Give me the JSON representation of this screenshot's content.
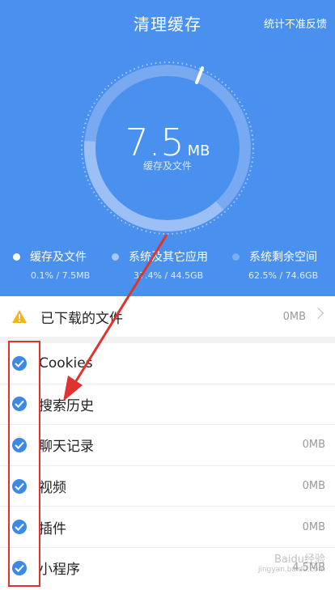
{
  "header": {
    "title": "清理缓存",
    "feedback_link": "统计不准反馈",
    "total_size_value": "7.5",
    "total_size_unit": "MB",
    "total_size_label": "缓存及文件"
  },
  "stats": [
    {
      "name": "缓存及文件",
      "value": "0.1% / 7.5MB",
      "dot_color": "#ffffff"
    },
    {
      "name": "系统及其它应用",
      "value": "37.4% / 44.5GB",
      "dot_color": "#a9c8f5"
    },
    {
      "name": "系统剩余空间",
      "value": "62.5% / 74.6GB",
      "dot_color": "#7eaef0"
    }
  ],
  "downloaded": {
    "label": "已下载的文件",
    "size": "0MB",
    "icon": "warning-icon"
  },
  "items": [
    {
      "label": "Cookies",
      "size": "",
      "checked": true
    },
    {
      "label": "搜索历史",
      "size": "",
      "checked": true
    },
    {
      "label": "聊天记录",
      "size": "0MB",
      "checked": true
    },
    {
      "label": "视频",
      "size": "0MB",
      "checked": true
    },
    {
      "label": "插件",
      "size": "0MB",
      "checked": true
    },
    {
      "label": "小程序",
      "size": "4.5MB",
      "checked": true
    }
  ],
  "watermark": {
    "text": "Baidu经验",
    "sub": "jingyan.baidu.com"
  },
  "colors": {
    "header_bg": "#4a90ee",
    "check": "#3d8ae6",
    "annotation": "#e0322f"
  }
}
